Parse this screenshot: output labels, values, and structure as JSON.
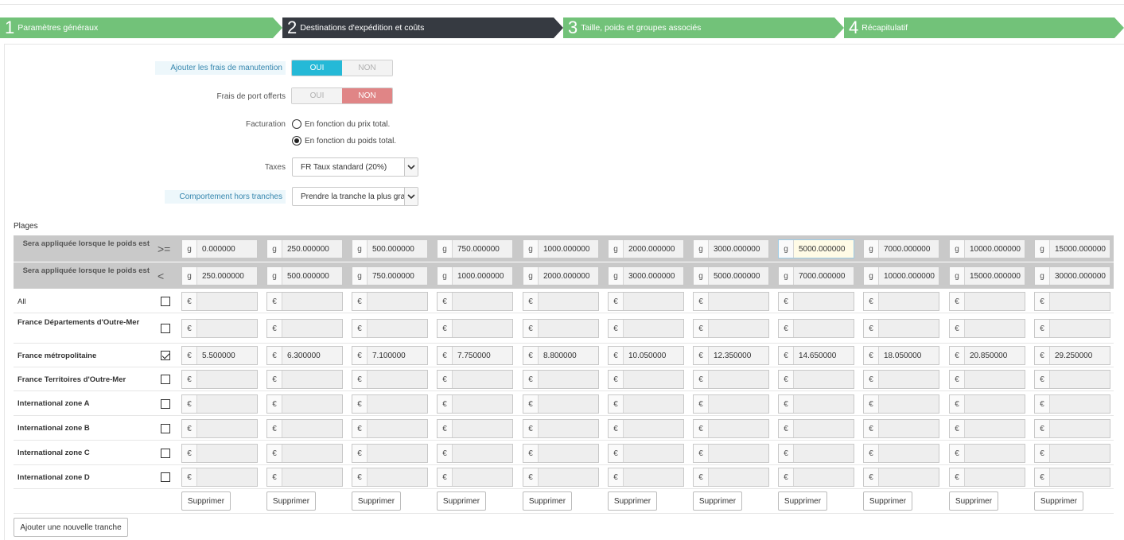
{
  "steps": [
    {
      "num": "1",
      "label": "Paramètres généraux"
    },
    {
      "num": "2",
      "label": "Destinations d'expédition et coûts"
    },
    {
      "num": "3",
      "label": "Taille, poids et groupes associés"
    },
    {
      "num": "4",
      "label": "Récapitulatif"
    }
  ],
  "form": {
    "handling": {
      "label": "Ajouter les frais de manutention",
      "yes": "OUI",
      "no": "NON",
      "value": "OUI"
    },
    "free_shipping": {
      "label": "Frais de port offerts",
      "yes": "OUI",
      "no": "NON",
      "value": "NON"
    },
    "billing": {
      "label": "Facturation",
      "options": [
        "En fonction du prix total.",
        "En fonction du poids total."
      ],
      "selected": "En fonction du poids total."
    },
    "taxes": {
      "label": "Taxes",
      "value": "FR Taux standard (20%)"
    },
    "out_of_range": {
      "label": "Comportement hors tranches",
      "value": "Prendre la tranche la plus grande"
    }
  },
  "ranges": {
    "title": "Plages",
    "unit": "g",
    "currency": "€",
    "from_label": "Sera appliquée lorsque le poids est",
    "from_symbol": ">=",
    "to_label": "Sera appliquée lorsque le poids est",
    "to_symbol": "<",
    "from": [
      "0.000000",
      "250.000000",
      "500.000000",
      "750.000000",
      "1000.000000",
      "2000.000000",
      "3000.000000",
      "5000.000000",
      "7000.000000",
      "10000.000000",
      "15000.000000"
    ],
    "to": [
      "250.000000",
      "500.000000",
      "750.000000",
      "1000.000000",
      "2000.000000",
      "3000.000000",
      "5000.000000",
      "7000.000000",
      "10000.000000",
      "15000.000000",
      "30000.000000"
    ],
    "zones": [
      {
        "name": "All",
        "checked": false,
        "prices": [
          "",
          "",
          "",
          "",
          "",
          "",
          "",
          "",
          "",
          "",
          ""
        ]
      },
      {
        "name": "France Départements d'Outre-Mer",
        "checked": false,
        "prices": [
          "",
          "",
          "",
          "",
          "",
          "",
          "",
          "",
          "",
          "",
          ""
        ]
      },
      {
        "name": "France métropolitaine",
        "checked": true,
        "prices": [
          "5.500000",
          "6.300000",
          "7.100000",
          "7.750000",
          "8.800000",
          "10.050000",
          "12.350000",
          "14.650000",
          "18.050000",
          "20.850000",
          "29.250000"
        ]
      },
      {
        "name": "France Territoires d'Outre-Mer",
        "checked": false,
        "prices": [
          "",
          "",
          "",
          "",
          "",
          "",
          "",
          "",
          "",
          "",
          ""
        ]
      },
      {
        "name": "International zone A",
        "checked": false,
        "prices": [
          "",
          "",
          "",
          "",
          "",
          "",
          "",
          "",
          "",
          "",
          ""
        ]
      },
      {
        "name": "International zone B",
        "checked": false,
        "prices": [
          "",
          "",
          "",
          "",
          "",
          "",
          "",
          "",
          "",
          "",
          ""
        ]
      },
      {
        "name": "International zone C",
        "checked": false,
        "prices": [
          "",
          "",
          "",
          "",
          "",
          "",
          "",
          "",
          "",
          "",
          ""
        ]
      },
      {
        "name": "International zone D",
        "checked": false,
        "prices": [
          "",
          "",
          "",
          "",
          "",
          "",
          "",
          "",
          "",
          "",
          ""
        ]
      }
    ],
    "delete_label": "Supprimer",
    "add_label": "Ajouter une nouvelle tranche"
  }
}
